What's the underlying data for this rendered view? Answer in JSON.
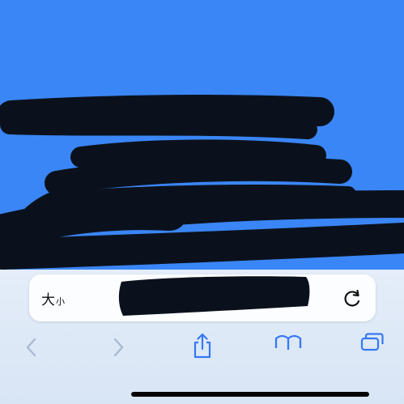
{
  "browser": {
    "address_bar": {
      "text_size_label_large": "大",
      "text_size_label_small": "小",
      "url": ""
    },
    "icons": {
      "reload": "reload-icon",
      "back": "chevron-left-icon",
      "forward": "chevron-right-icon",
      "share": "share-icon",
      "bookmarks": "book-icon",
      "tabs": "tabs-icon"
    },
    "colors": {
      "page_background": "#3a86f6",
      "toolbar_background": "#dde8f6",
      "icon_active": "#3478f6",
      "icon_disabled": "#a9bad0",
      "redaction": "#0b111c"
    }
  }
}
